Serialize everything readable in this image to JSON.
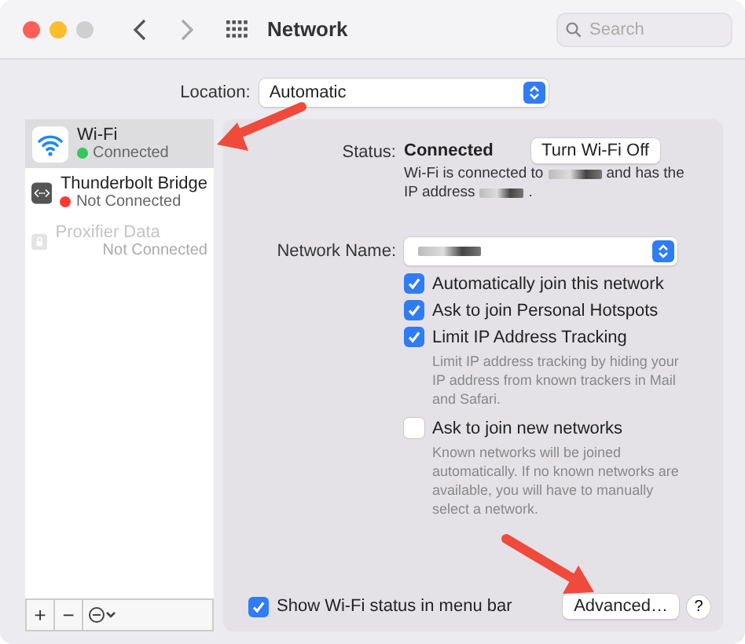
{
  "window": {
    "title": "Network",
    "search": {
      "placeholder": "Search"
    }
  },
  "location": {
    "label": "Location:",
    "value": "Automatic"
  },
  "services": [
    {
      "name": "Wi-Fi",
      "status": "Connected",
      "kind": "wifi",
      "color": "#34c759",
      "selected": true,
      "disabled": false
    },
    {
      "name": "Thunderbolt Bridge",
      "status": "Not Connected",
      "kind": "bridge",
      "color": "#ff3b30",
      "selected": false,
      "disabled": false
    },
    {
      "name": "Proxifier Data",
      "status": "Not Connected",
      "kind": "lock",
      "selected": false,
      "disabled": true
    }
  ],
  "service_toolbar": [
    "+",
    "−"
  ],
  "status": {
    "label": "Status:",
    "value": "Connected",
    "button": "Turn Wi-Fi Off",
    "description": [
      "Wi-Fi is connected to",
      "and has the",
      "IP address",
      "."
    ]
  },
  "network_name": {
    "label": "Network Name:"
  },
  "options": [
    {
      "label": "Automatically join this network",
      "checked": true
    },
    {
      "label": "Ask to join Personal Hotspots",
      "checked": true
    },
    {
      "label": "Limit IP Address Tracking",
      "checked": true,
      "note": "Limit IP address tracking by hiding your IP address from known trackers in Mail and Safari."
    },
    {
      "label": "Ask to join new networks",
      "checked": false,
      "note": "Known networks will be joined automatically. If no known networks are available, you will have to manually select a network."
    }
  ],
  "footer": {
    "show_status": {
      "label": "Show Wi-Fi status in menu bar",
      "checked": true
    },
    "buttons": [
      "Advanced…",
      "?"
    ]
  }
}
